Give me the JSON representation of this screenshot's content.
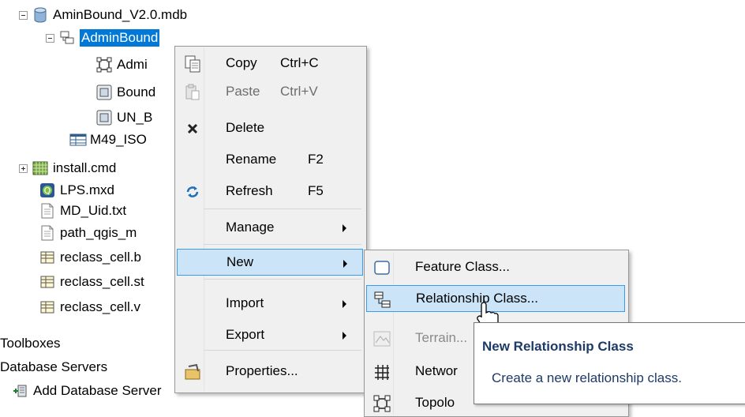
{
  "tree": {
    "items": [
      {
        "label": "AminBound_V2.0.mdb",
        "icon": "database-icon"
      },
      {
        "label": "AdminBound",
        "icon": "feature-dataset-icon"
      },
      {
        "label": "Admi",
        "icon": "topology-icon"
      },
      {
        "label": "Bound",
        "icon": "polygon-feature-class-icon"
      },
      {
        "label": "UN_B",
        "icon": "polygon-feature-class-icon"
      },
      {
        "label": "M49_ISO",
        "icon": "table-icon"
      },
      {
        "label": "install.cmd",
        "icon": "raster-icon"
      },
      {
        "label": "LPS.mxd",
        "icon": "map-document-icon"
      },
      {
        "label": "MD_Uid.txt",
        "icon": "text-file-icon"
      },
      {
        "label": "path_qgis_m",
        "icon": "text-file-icon"
      },
      {
        "label": "reclass_cell.b",
        "icon": "table-icon"
      },
      {
        "label": "reclass_cell.st",
        "icon": "table-icon"
      },
      {
        "label": "reclass_cell.v",
        "icon": "table-icon"
      },
      {
        "label": "Toolboxes",
        "icon": ""
      },
      {
        "label": "Database Servers",
        "icon": ""
      },
      {
        "label": "Add Database Server",
        "icon": "add-database-server-icon"
      }
    ]
  },
  "context_menu": {
    "copy": {
      "label": "Copy",
      "shortcut": "Ctrl+C"
    },
    "paste": {
      "label": "Paste",
      "shortcut": "Ctrl+V"
    },
    "delete": {
      "label": "Delete"
    },
    "rename": {
      "label": "Rename",
      "shortcut": "F2"
    },
    "refresh": {
      "label": "Refresh",
      "shortcut": "F5"
    },
    "manage": {
      "label": "Manage"
    },
    "new": {
      "label": "New"
    },
    "import": {
      "label": "Import"
    },
    "export": {
      "label": "Export"
    },
    "properties": {
      "label": "Properties..."
    }
  },
  "submenu": {
    "feature_class": "Feature Class...",
    "relationship_class": "Relationship Class...",
    "terrain": "Terrain...",
    "network": "Networ",
    "topology": "Topolo"
  },
  "tooltip": {
    "title": "New Relationship Class",
    "description": "Create a new relationship class."
  },
  "colors": {
    "selection": "#0078d7",
    "menu_highlight": "#cce4f7",
    "menu_highlight_border": "#3c9ae8",
    "tooltip_text": "#1e3a66"
  }
}
